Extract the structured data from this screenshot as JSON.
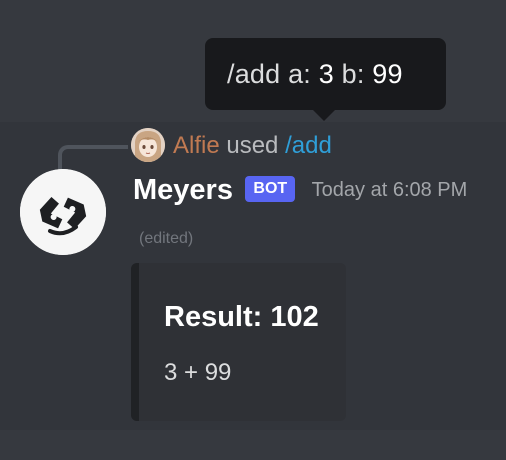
{
  "tooltip": {
    "command": "/add",
    "option_a_label": "a:",
    "option_a_value": "3",
    "option_b_label": "b:",
    "option_b_value": "99"
  },
  "reply": {
    "username": "Alfie",
    "action": "used",
    "command": "/add"
  },
  "message": {
    "username": "Meyers",
    "bot_tag": "BOT",
    "timestamp": "Today at 6:08 PM",
    "edited": "(edited)"
  },
  "embed": {
    "title": "Result: 102",
    "description": "3 + 99"
  },
  "colors": {
    "background": "#36393f",
    "message_hover": "#32353b",
    "tooltip": "#18191c",
    "bot_tag": "#5865f2",
    "reply_user": "#c17a52",
    "command_link": "#2f9fd8",
    "embed_background": "#2f3136"
  },
  "icons": {
    "user_avatar": "anime-avatar-icon",
    "bot_avatar": "bot-logo-icon"
  }
}
